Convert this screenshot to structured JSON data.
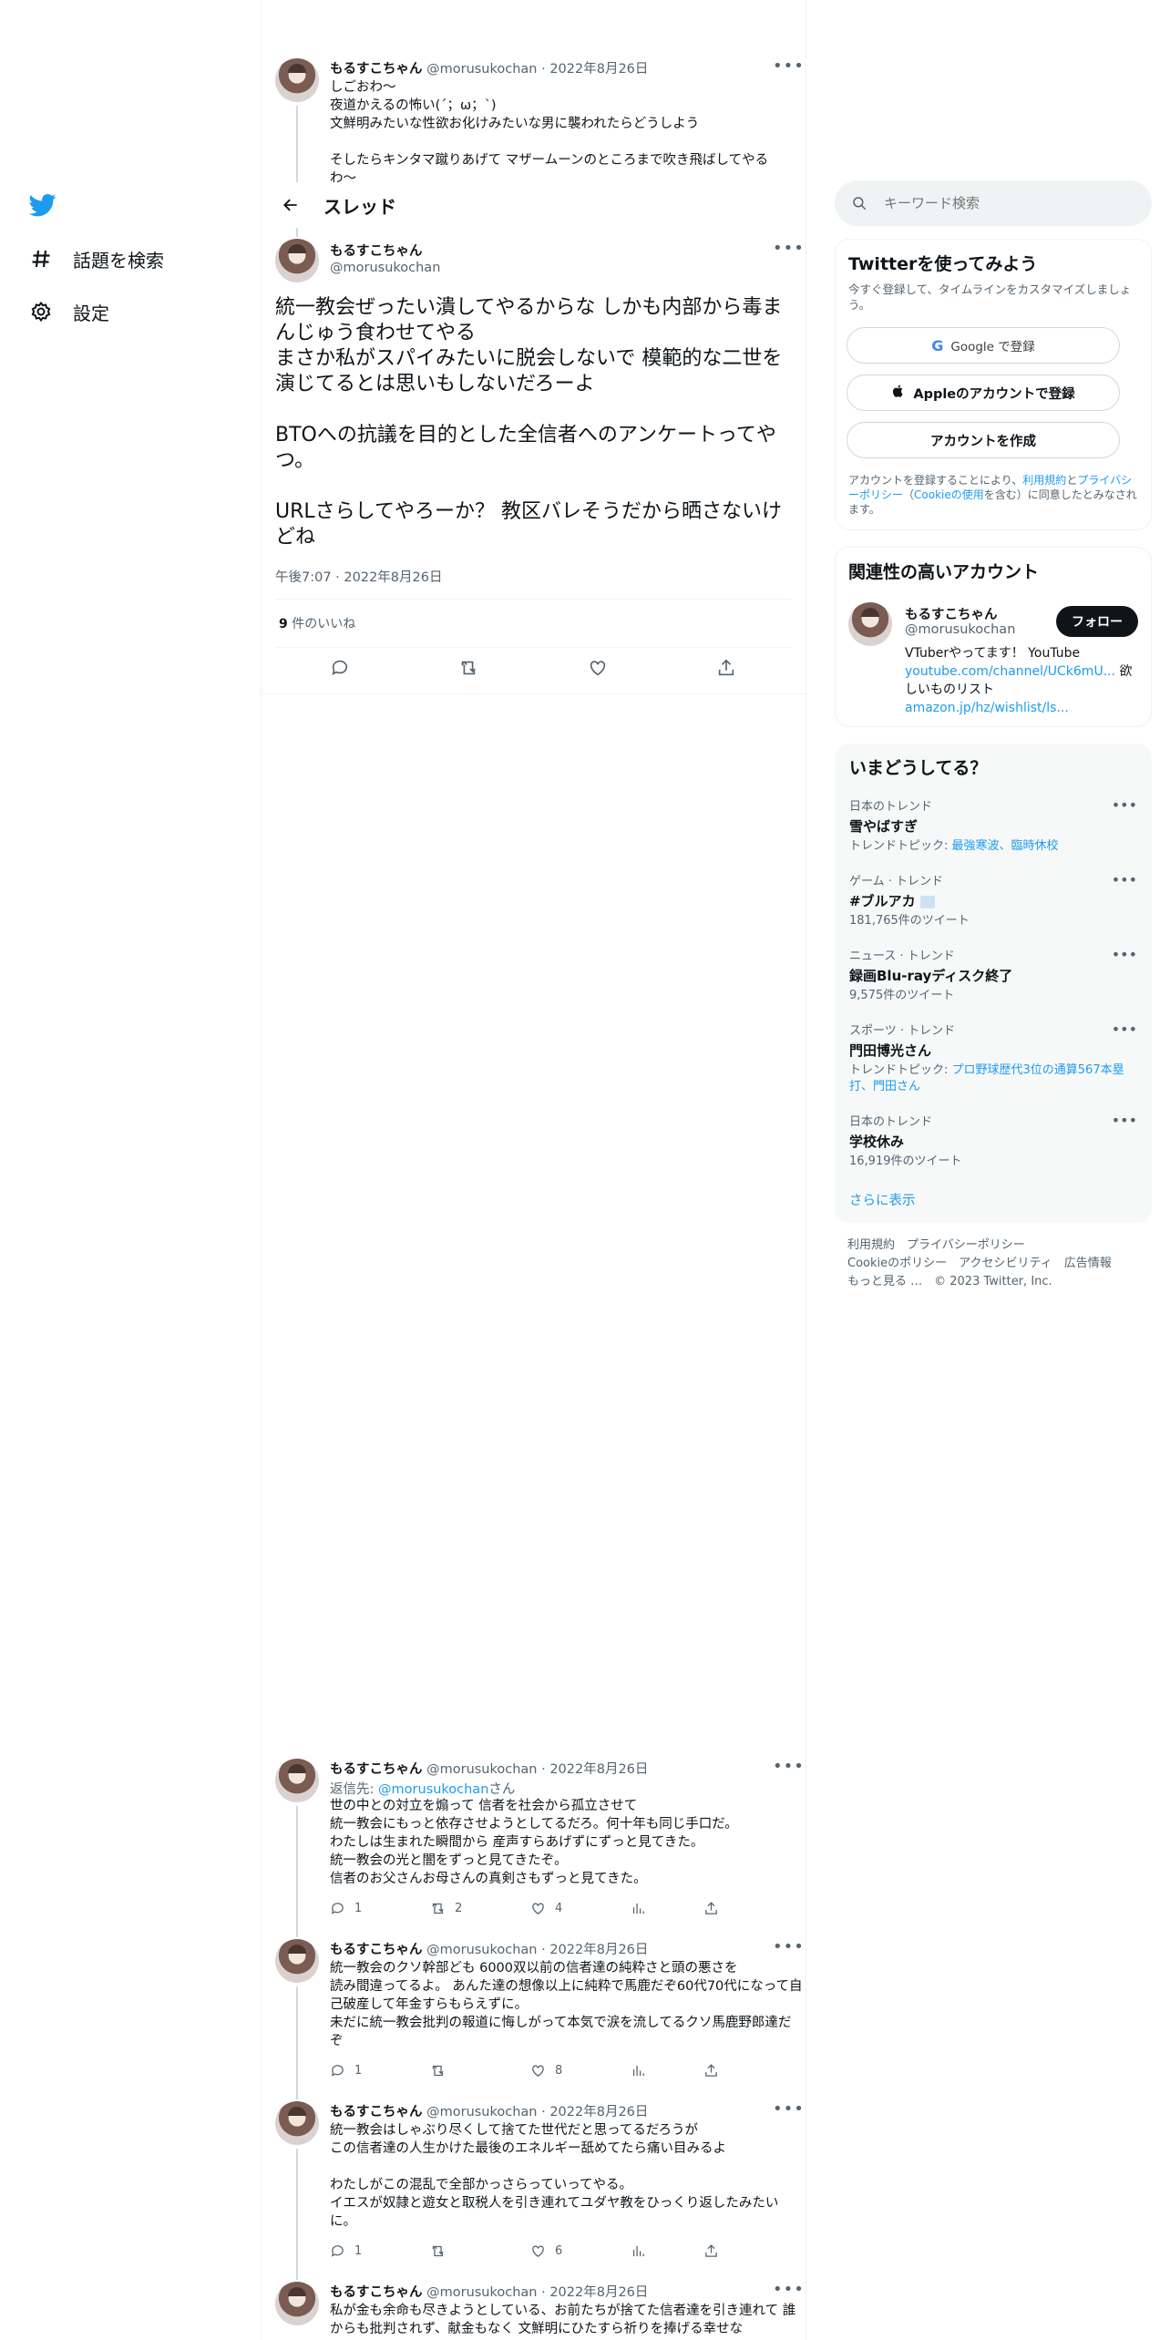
{
  "nav": {
    "explore_label": "話題を検索",
    "settings_label": "設定"
  },
  "header": {
    "title": "スレッド"
  },
  "prev_tweet": {
    "name": "もるすこちゃん",
    "meta": "@morusukochan · 2022年8月26日",
    "body": "しごおわ〜\n夜道かえるの怖い(´；ω；`)\n文鮮明みたいな性欲お化けみたいな男に襲われたらどうしよう\n\nそしたらキンタマ蹴りあげて マザームーンのところまで吹き飛ばしてやるわ〜"
  },
  "main_tweet": {
    "name": "もるすこちゃん",
    "handle": "@morusukochan",
    "body": "統一教会ぜったい潰してやるからな しかも内部から毒まんじゅう食わせてやる\nまさか私がスパイみたいに脱会しないで 模範的な二世を演じてるとは思いもしないだろーよ\n\nBTOへの抗議を目的とした全信者へのアンケートってやつ。\n\nURLさらしてやろーか？ 教区バレそうだから晒さないけどね",
    "time": "午後7:07 · 2022年8月26日",
    "likes_count": "9",
    "likes_label": " 件のいいね"
  },
  "replies": [
    {
      "name": "もるすこちゃん",
      "meta": "@morusukochan · 2022年8月26日",
      "reply_prefix": "返信先: ",
      "reply_to": "@morusukochan",
      "reply_suffix": "さん",
      "body": "世の中との対立を煽って 信者を社会から孤立させて\n統一教会にもっと依存させようとしてるだろ。何十年も同じ手口だ。\nわたしは生まれた瞬間から 産声すらあげずにずっと見てきた。\n統一教会の光と闇をずっと見てきたぞ。\n信者のお父さんお母さんの真剣さもずっと見てきた。",
      "replies": "1",
      "retweets": "2",
      "likes": "4"
    },
    {
      "name": "もるすこちゃん",
      "meta": "@morusukochan · 2022年8月26日",
      "body": "統一教会のクソ幹部ども 6000双以前の信者達の純粋さと頭の悪さを\n読み間違ってるよ。 あんた達の想像以上に純粋で馬鹿だぞ60代70代になって自己破産して年金すらもらえずに。\n未だに統一教会批判の報道に悔しがって本気で涙を流してるクソ馬鹿野郎達だぞ",
      "replies": "1",
      "retweets": "",
      "likes": "8"
    },
    {
      "name": "もるすこちゃん",
      "meta": "@morusukochan · 2022年8月26日",
      "body": "統一教会はしゃぶり尽くして捨てた世代だと思ってるだろうが\nこの信者達の人生かけた最後のエネルギー舐めてたら痛い目みるよ\n\nわたしがこの混乱で全部かっさらっていってやる。\nイエスが奴隷と遊女と取税人を引き連れてユダヤ教をひっくり返したみたいに。",
      "replies": "1",
      "retweets": "",
      "likes": "6"
    },
    {
      "name": "もるすこちゃん",
      "meta": "@morusukochan · 2022年8月26日",
      "body": "私が金も余命も尽きようとしている、お前たちが捨てた信者達を引き連れて 誰からも批判されず、献金もなく 文鮮明にひたすら祈りを捧げる幸せな"
    }
  ],
  "search": {
    "placeholder": "キーワード検索"
  },
  "signup": {
    "title": "Twitterを使ってみよう",
    "desc": "今すぐ登録して、タイムラインをカスタマイズしましょう。",
    "google_label": "Google で登録",
    "apple_label": "Appleのアカウントで登録",
    "create_label": "アカウントを作成",
    "legal_1": "アカウントを登録することにより、",
    "legal_terms": "利用規約",
    "legal_2": "と",
    "legal_privacy": "プライバシーポリシー",
    "legal_3": "（",
    "legal_cookie": "Cookieの使用",
    "legal_4": "を含む）に同意したとみなされます。"
  },
  "related": {
    "title": "関連性の高いアカウント",
    "name": "もるすこちゃん",
    "handle": "@morusukochan",
    "follow_label": "フォロー",
    "bio_1": "VTuberやってます！ YouTube ",
    "bio_link1": "youtube.com/channel/UCk6mU...",
    "bio_2": " 欲しいものリスト ",
    "bio_link2": "amazon.jp/hz/wishlist/ls..."
  },
  "trends": {
    "title": "いまどうしてる？",
    "items": [
      {
        "category": "日本のトレンド",
        "name": "雪やばすぎ",
        "sub_prefix": "トレンドトピック: ",
        "sub_link": "最強寒波、臨時休校",
        "sub": ""
      },
      {
        "category": "ゲーム · トレンド",
        "name": "#ブルアカ",
        "sub": "181,765件のツイート"
      },
      {
        "category": "ニュース · トレンド",
        "name": "録画Blu-rayディスク終了",
        "sub": "9,575件のツイート"
      },
      {
        "category": "スポーツ · トレンド",
        "name": "門田博光さん",
        "sub_prefix": "トレンドトピック: ",
        "sub_link": "プロ野球歴代3位の通算567本塁打、門田さん",
        "sub": ""
      },
      {
        "category": "日本のトレンド",
        "name": "学校休み",
        "sub": "16,919件のツイート"
      }
    ],
    "show_more": "さらに表示"
  },
  "footer": {
    "line1": "利用規約　プライバシーポリシー",
    "line2": "Cookieのポリシー　アクセシビリティ　広告情報",
    "line3": "もっと見る …　© 2023 Twitter, Inc."
  },
  "colors": {
    "brand": "#1d9bf0",
    "text": "#0f1419",
    "muted": "#536471"
  }
}
